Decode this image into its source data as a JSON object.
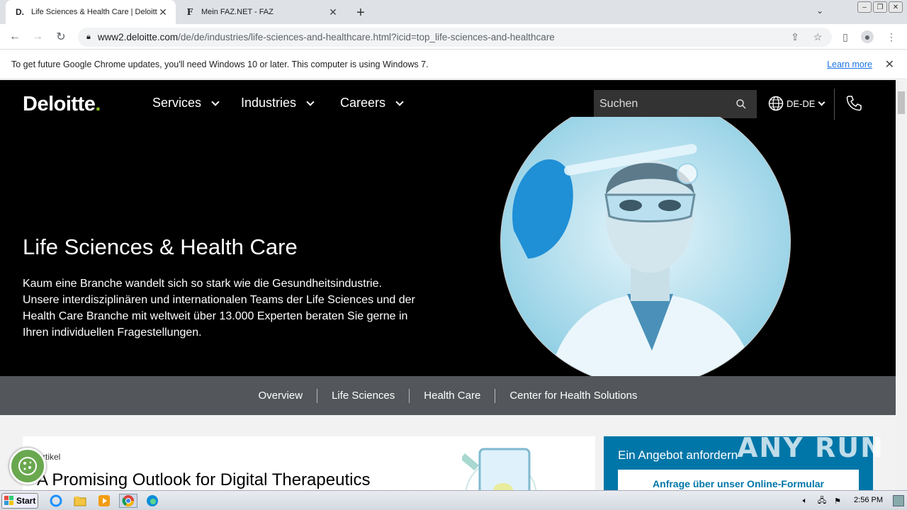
{
  "browser": {
    "tabs": [
      {
        "favicon": "D.",
        "title": "Life Sciences & Health Care | Deloitte"
      },
      {
        "favicon": "F",
        "title": "Mein FAZ.NET - FAZ"
      }
    ],
    "url_host": "www2.deloitte.com",
    "url_path": "/de/de/industries/life-sciences-and-healthcare.html?icid=top_life-sciences-and-healthcare",
    "infobar_text": "To get future Google Chrome updates, you'll need Windows 10 or later. This computer is using Windows 7.",
    "learn_more": "Learn more"
  },
  "header": {
    "logo": "Deloitte",
    "logo_dot": ".",
    "nav": [
      "Services",
      "Industries",
      "Careers"
    ],
    "search_placeholder": "Suchen",
    "lang": "DE-DE"
  },
  "hero": {
    "title": "Life Sciences & Health Care",
    "text": "Kaum eine Branche wandelt sich so stark wie die Gesundheitsindustrie. Unsere interdisziplinären und internationalen Teams der Life Sciences und der Health Care Branche mit weltweit über 13.000 Experten beraten Sie gerne in Ihren individuellen Fragestellungen."
  },
  "subnav": [
    "Overview",
    "Life Sciences",
    "Health Care",
    "Center for Health Solutions"
  ],
  "card": {
    "kicker": "Artikel",
    "title": "A Promising Outlook for Digital Therapeutics"
  },
  "angebot": {
    "title": "Ein Angebot anfordern",
    "button": "Anfrage über unser Online-Formular"
  },
  "watermark": "ANY RUN",
  "taskbar": {
    "start": "Start",
    "clock": "2:56 PM"
  },
  "colors": {
    "accent_green": "#86bc25",
    "hero_bg": "#000000",
    "subnav_bg": "#53565a",
    "angebot_bg": "#0076a8"
  }
}
